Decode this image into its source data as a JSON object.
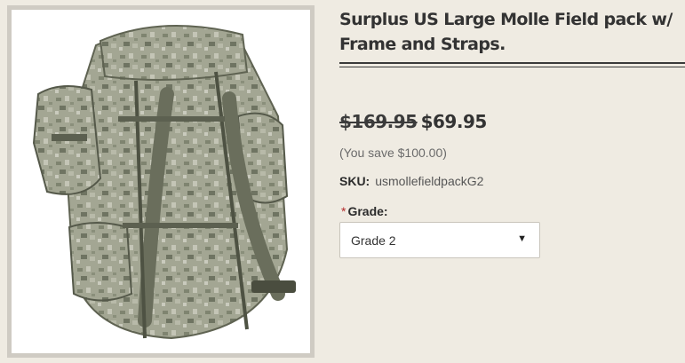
{
  "product": {
    "title": "Surplus US Large Molle Field pack w/ Frame and Straps.",
    "image_icon": "backpack-photo",
    "old_price": "$169.95",
    "new_price": "$69.95",
    "savings": "(You save $100.00)",
    "sku_label": "SKU:",
    "sku_value": "usmollefieldpackG2",
    "grade": {
      "required_mark": "*",
      "label": "Grade:",
      "selected": "Grade 2",
      "caret_icon": "chevron-down-icon"
    }
  },
  "colors": {
    "background": "#efebe2",
    "required": "#b32a2a",
    "camo_base": "#9a9d8a"
  }
}
